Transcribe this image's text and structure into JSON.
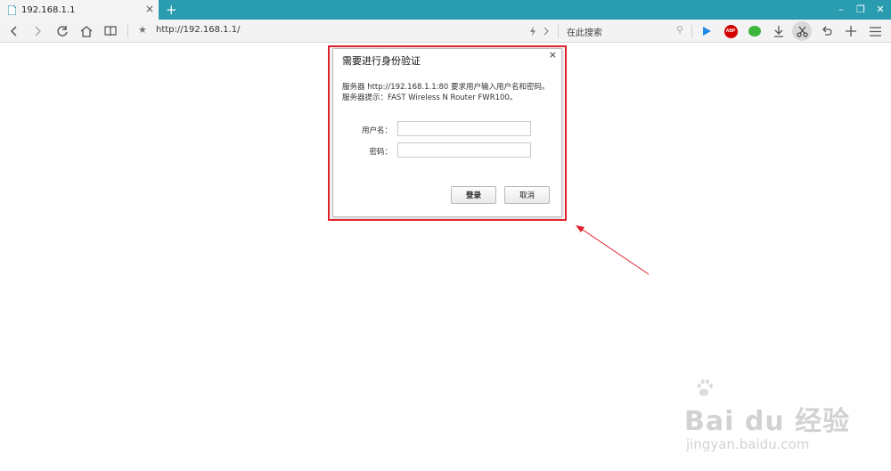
{
  "tab": {
    "title": "192.168.1.1",
    "close": "×",
    "new": "+"
  },
  "window_controls": {
    "minimize": "–",
    "restore": "❐",
    "close": "✕"
  },
  "toolbar": {
    "address": "http://192.168.1.1/",
    "search_placeholder": "在此搜索"
  },
  "dialog": {
    "title": "需要进行身份验证",
    "close": "×",
    "message_line1": "服务器 http://192.168.1.1:80 要求用户输入用户名和密码。",
    "message_line2": "服务器提示：FAST Wireless N Router FWR100。",
    "username_label": "用户名：",
    "password_label": "密码：",
    "username_value": "",
    "password_value": "",
    "login_button": "登录",
    "cancel_button": "取消"
  },
  "watermark": {
    "logo_text": "Bai du 经验",
    "url": "jingyan.baidu.com"
  },
  "colors": {
    "tabbar": "#2a9cb0",
    "highlight": "#e0202b",
    "abp": "#d40000",
    "wechat": "#3bb53b"
  },
  "icons": [
    "page-icon",
    "back-icon",
    "forward-icon",
    "reload-icon",
    "home-icon",
    "reader-icon",
    "star-icon",
    "lightning-icon",
    "chevron-right-icon",
    "search-icon",
    "play-icon",
    "abp-icon",
    "wechat-icon",
    "download-icon",
    "scissors-icon",
    "undo-icon",
    "plus-icon",
    "menu-icon"
  ]
}
